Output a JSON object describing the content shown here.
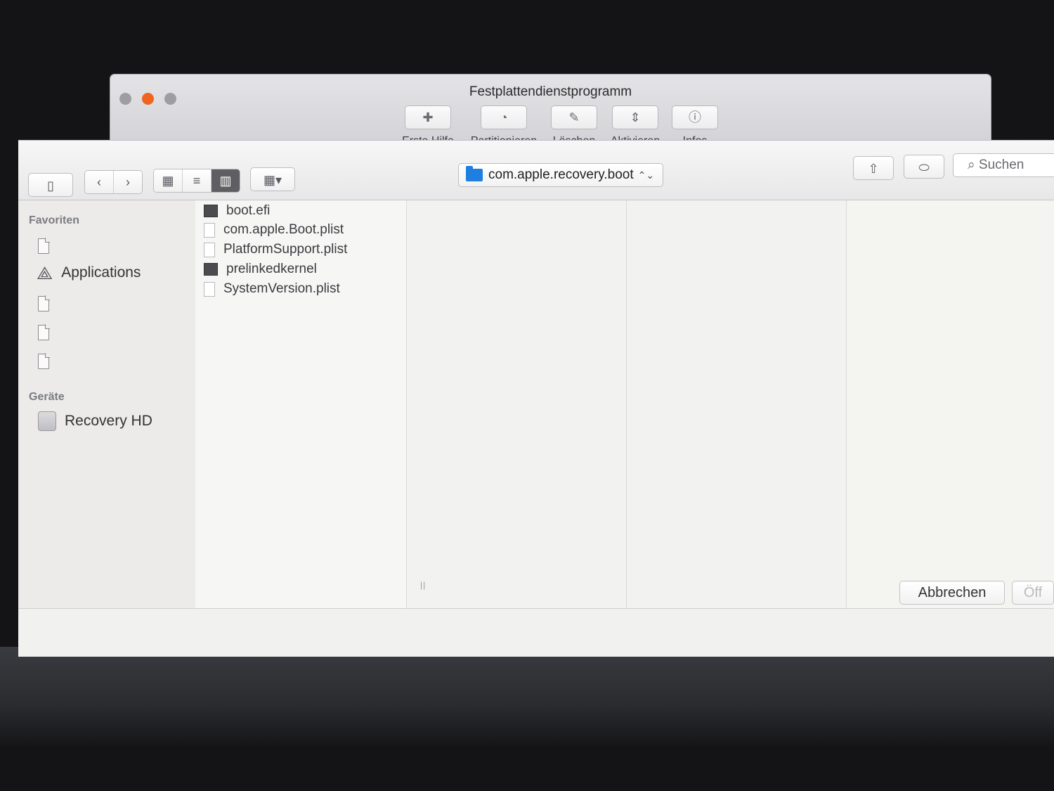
{
  "disk_utility": {
    "title": "Festplattendienstprogramm",
    "tools": [
      {
        "label": "Erste Hilfe",
        "icon": "first-aid-icon"
      },
      {
        "label": "Partitionieren",
        "icon": "partition-icon"
      },
      {
        "label": "Löschen",
        "icon": "erase-icon"
      },
      {
        "label": "Aktivieren",
        "icon": "mount-icon"
      },
      {
        "label": "Infos",
        "icon": "info-icon"
      }
    ]
  },
  "panel": {
    "path": "com.apple.recovery.boot",
    "search_placeholder": "Suchen",
    "view_mode": "columns"
  },
  "sidebar": {
    "favorites_header": "Favoriten",
    "favorites": [
      {
        "label": "",
        "icon": "document-icon"
      },
      {
        "label": "Applications",
        "icon": "applications-icon"
      },
      {
        "label": "",
        "icon": "document-icon"
      },
      {
        "label": "",
        "icon": "document-icon"
      },
      {
        "label": "",
        "icon": "document-icon"
      }
    ],
    "devices_header": "Geräte",
    "devices": [
      {
        "label": "Recovery HD",
        "icon": "hard-drive-icon"
      }
    ]
  },
  "files": [
    {
      "name": "boot.efi",
      "kind": "executable"
    },
    {
      "name": "com.apple.Boot.plist",
      "kind": "document"
    },
    {
      "name": "PlatformSupport.plist",
      "kind": "document"
    },
    {
      "name": "prelinkedkernel",
      "kind": "executable"
    },
    {
      "name": "SystemVersion.plist",
      "kind": "document"
    }
  ],
  "buttons": {
    "cancel": "Abbrechen",
    "open": "Öff"
  },
  "colors": {
    "minimize": "#f0641f",
    "folder": "#1f7fe0",
    "active_view": "#5f5f63"
  }
}
